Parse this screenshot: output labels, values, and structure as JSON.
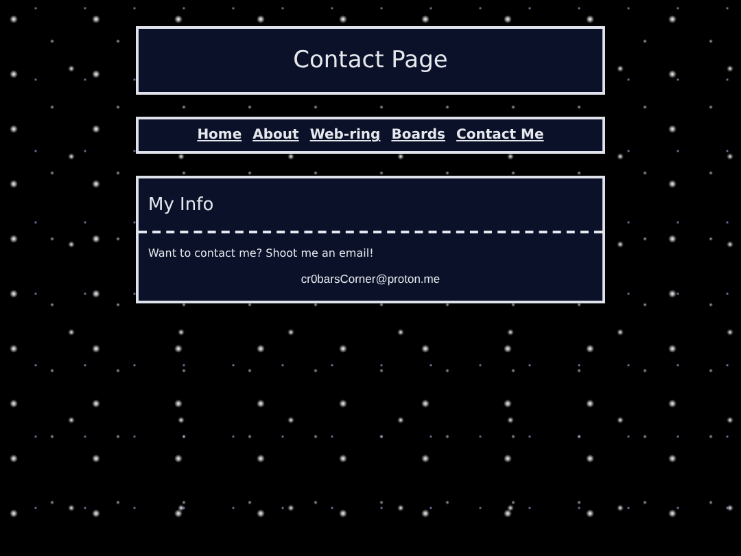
{
  "header": {
    "title": "Contact Page"
  },
  "nav": [
    {
      "label": "Home"
    },
    {
      "label": "About"
    },
    {
      "label": "Web-ring"
    },
    {
      "label": "Boards"
    },
    {
      "label": "Contact Me"
    }
  ],
  "info": {
    "heading": "My Info",
    "text": "Want to contact me? Shoot me an email!",
    "email": "cr0barsCorner@proton.me"
  }
}
